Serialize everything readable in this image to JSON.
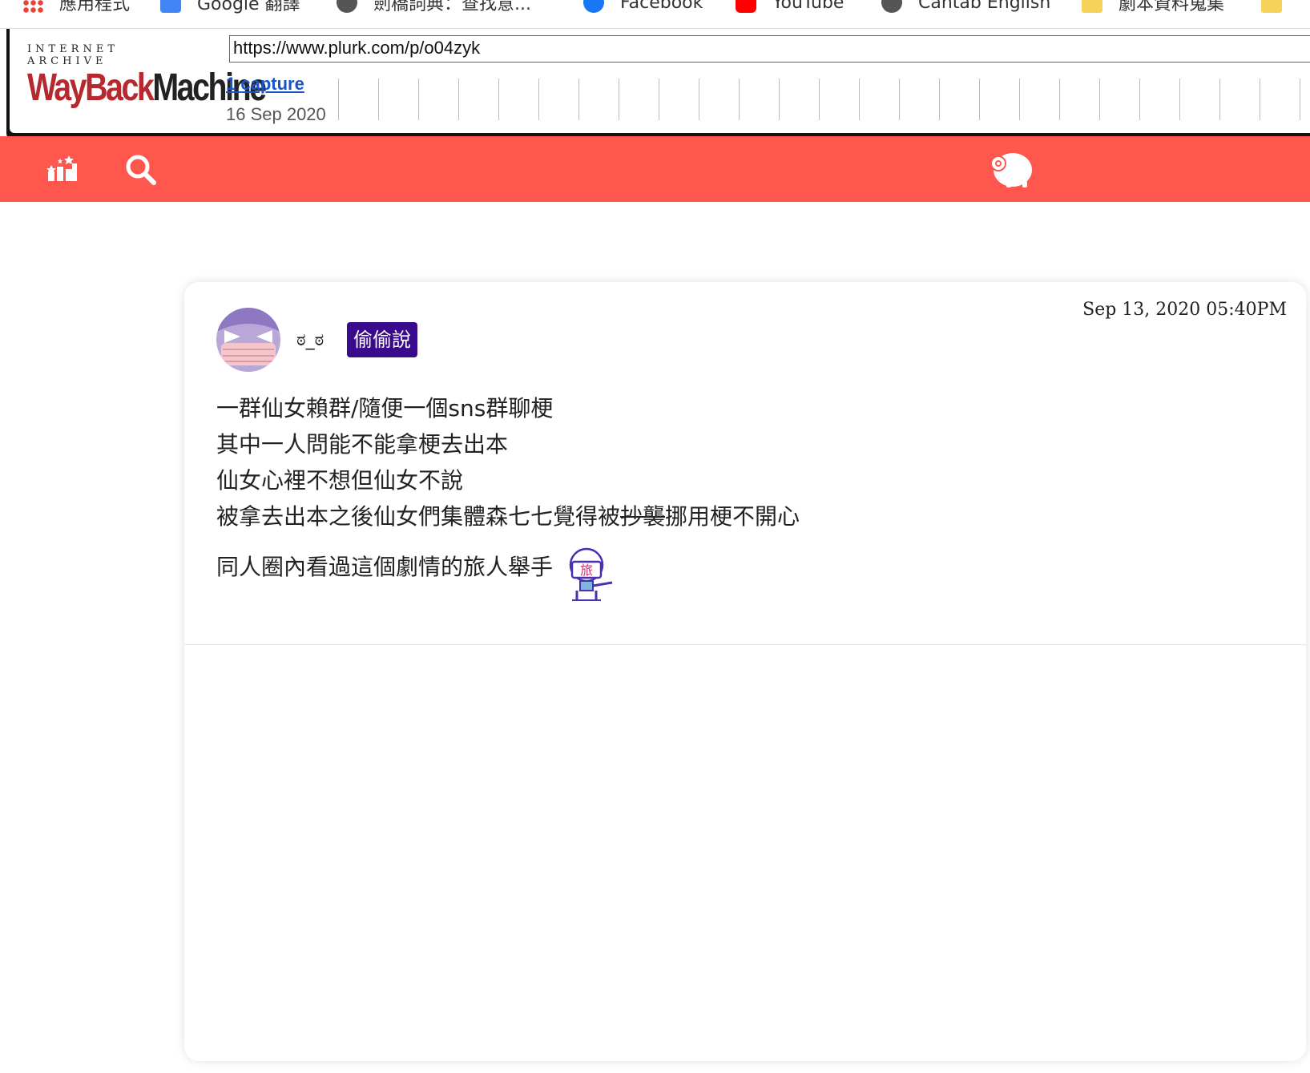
{
  "bookmarks": {
    "items": [
      {
        "label": "應用程式",
        "icon": "apps-grid-icon"
      },
      {
        "label": "Google 翻譯",
        "icon": "translate-icon"
      },
      {
        "label": "劍橋詞典：查找意...",
        "icon": "globe-icon"
      },
      {
        "label": "Facebook",
        "icon": "facebook-icon"
      },
      {
        "label": "YouTube",
        "icon": "youtube-icon"
      },
      {
        "label": "Cantab English",
        "icon": "globe-icon"
      },
      {
        "label": "劇本資料蒐集",
        "icon": "folder-icon"
      }
    ]
  },
  "wayback": {
    "logo_top": "INTERNET ARCHIVE",
    "logo_wayback": "WayBack",
    "logo_machine": "Machine",
    "url": "https://www.plurk.com/p/o04zyk",
    "captures_label": "1 capture",
    "capture_date": "16 Sep 2020"
  },
  "plurk_header": {
    "background_color": "#ff574d",
    "icons": [
      "stats-icon",
      "search-icon",
      "plurk-logo-icon"
    ]
  },
  "post": {
    "username": "ಠ_ಠ",
    "badge": "偷偷說",
    "badge_color": "#3a0a8c",
    "timestamp": "Sep 13, 2020 05:40PM",
    "lines": [
      "一群仙女賴群/隨便一個sns群聊梗",
      "其中一人問能不能拿梗去出本",
      "仙女心裡不想但仙女不說"
    ],
    "line4_before": "被拿去出本之後仙女們集體森七七覺得被",
    "line4_struck": "抄襲",
    "line4_after": "挪用梗不開心",
    "line5": "同人圈內看過這個劇情的旅人舉手",
    "emoticon": "traveler-raise-hand-icon",
    "emoticon_text": "旅"
  }
}
